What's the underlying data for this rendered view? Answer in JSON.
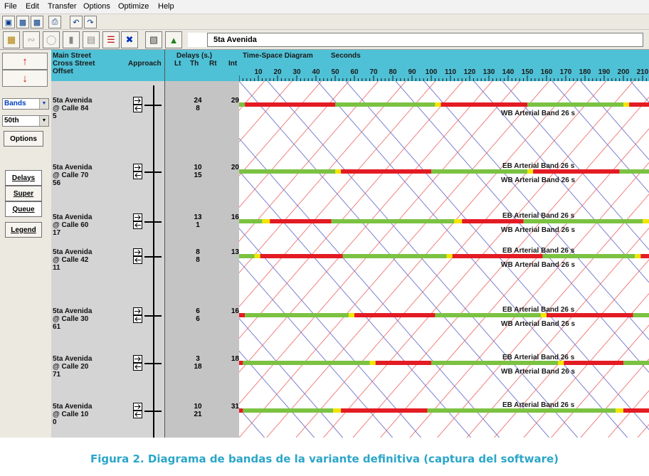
{
  "menu": [
    "File",
    "Edit",
    "Transfer",
    "Options",
    "Optimize",
    "Help"
  ],
  "route_name": "5ta Avenida",
  "left_panel": {
    "view_select": "Bands",
    "percentile_select": "50th",
    "options_label": "Options",
    "delays_label": "Delays",
    "super_label": "Super",
    "queue_label": "Queue",
    "legend_label": "Legend"
  },
  "header": {
    "main_street": "Main Street",
    "cross_street": "Cross Street",
    "offset": "Offset",
    "approach": "Approach",
    "delays": "Delays (s.)",
    "lt": "Lt",
    "th": "Th",
    "rt": "Rt",
    "int": "Int",
    "tsd_title": "Time-Space Diagram",
    "seconds": "Seconds",
    "ticks": [
      "10",
      "20",
      "30",
      "40",
      "50",
      "60",
      "70",
      "80",
      "90",
      "100",
      "110",
      "120",
      "130",
      "140",
      "150",
      "160",
      "170",
      "180",
      "190",
      "200",
      "210"
    ]
  },
  "intersections": [
    {
      "main": "5ta Avenida",
      "cross": "@ Calle 84",
      "offset": "5",
      "th1": "24",
      "th2": "8",
      "int": "29"
    },
    {
      "main": "5ta Avenida",
      "cross": "@ Calle 70",
      "offset": "56",
      "th1": "10",
      "th2": "15",
      "int": "20"
    },
    {
      "main": "5ta Avenida",
      "cross": "@ Calle 60",
      "offset": "17",
      "th1": "13",
      "th2": "1",
      "int": "16"
    },
    {
      "main": "5ta Avenida",
      "cross": "@ Calle 42",
      "offset": "11",
      "th1": "8",
      "th2": "8",
      "int": "13"
    },
    {
      "main": "5ta Avenida",
      "cross": "@ Calle 30",
      "offset": "61",
      "th1": "6",
      "th2": "6",
      "int": "16"
    },
    {
      "main": "5ta Avenida",
      "cross": "@ Calle 20",
      "offset": "71",
      "th1": "3",
      "th2": "18",
      "int": "18"
    },
    {
      "main": "5ta Avenida",
      "cross": "@ Calle 10",
      "offset": "0",
      "th1": "10",
      "th2": "21",
      "int": "31"
    }
  ],
  "band_labels": {
    "wb": "WB Arterial Band 26 s",
    "eb": "EB Arterial Band 26 s"
  },
  "signal_colors": {
    "green": "#7cc242",
    "red": "#e31b23",
    "yellow": "#f2e600",
    "band_eb": "#f08080",
    "band_wb": "#7b7fd0"
  },
  "signals": [
    [
      [
        "g",
        0,
        3
      ],
      [
        "r",
        3,
        50
      ],
      [
        "g",
        50,
        102
      ],
      [
        "y",
        102,
        105
      ],
      [
        "r",
        105,
        150
      ],
      [
        "g",
        150,
        200
      ],
      [
        "y",
        200,
        203
      ],
      [
        "r",
        203,
        215
      ]
    ],
    [
      [
        "g",
        0,
        50
      ],
      [
        "y",
        50,
        53
      ],
      [
        "r",
        53,
        100
      ],
      [
        "g",
        100,
        150
      ],
      [
        "y",
        150,
        153
      ],
      [
        "r",
        153,
        198
      ],
      [
        "g",
        198,
        215
      ]
    ],
    [
      [
        "g",
        0,
        12
      ],
      [
        "y",
        12,
        16
      ],
      [
        "r",
        16,
        48
      ],
      [
        "g",
        48,
        112
      ],
      [
        "y",
        112,
        116
      ],
      [
        "r",
        116,
        148
      ],
      [
        "g",
        148,
        210
      ],
      [
        "y",
        210,
        215
      ]
    ],
    [
      [
        "g",
        0,
        8
      ],
      [
        "y",
        8,
        11
      ],
      [
        "r",
        11,
        54
      ],
      [
        "g",
        54,
        108
      ],
      [
        "y",
        108,
        111
      ],
      [
        "r",
        111,
        158
      ],
      [
        "g",
        158,
        206
      ],
      [
        "y",
        206,
        209
      ],
      [
        "r",
        209,
        215
      ]
    ],
    [
      [
        "r",
        0,
        3
      ],
      [
        "g",
        3,
        57
      ],
      [
        "y",
        57,
        60
      ],
      [
        "r",
        60,
        102
      ],
      [
        "g",
        102,
        157
      ],
      [
        "y",
        157,
        160
      ],
      [
        "r",
        160,
        205
      ],
      [
        "g",
        205,
        215
      ]
    ],
    [
      [
        "r",
        0,
        2
      ],
      [
        "g",
        2,
        68
      ],
      [
        "y",
        68,
        71
      ],
      [
        "r",
        71,
        100
      ],
      [
        "g",
        100,
        166
      ],
      [
        "y",
        166,
        169
      ],
      [
        "r",
        169,
        200
      ],
      [
        "g",
        200,
        215
      ]
    ],
    [
      [
        "r",
        0,
        2
      ],
      [
        "g",
        2,
        49
      ],
      [
        "y",
        49,
        53
      ],
      [
        "r",
        53,
        98
      ],
      [
        "g",
        98,
        196
      ],
      [
        "y",
        196,
        200
      ],
      [
        "r",
        200,
        215
      ]
    ]
  ],
  "band_label_rows": [
    {
      "row": 0,
      "eb": "",
      "wb": "wb"
    },
    {
      "row": 1,
      "eb": "eb",
      "wb": "wb"
    },
    {
      "row": 2,
      "eb": "eb",
      "wb": "wb"
    },
    {
      "row": 3,
      "eb": "eb",
      "wb": "wb"
    },
    {
      "row": 4,
      "eb": "eb",
      "wb": "wb"
    },
    {
      "row": 5,
      "eb": "eb",
      "wb": "wb"
    },
    {
      "row": 6,
      "eb": "eb",
      "wb": ""
    }
  ],
  "caption": "Figura 2. Diagrama de bandas de la variante definitiva (captura del software)"
}
